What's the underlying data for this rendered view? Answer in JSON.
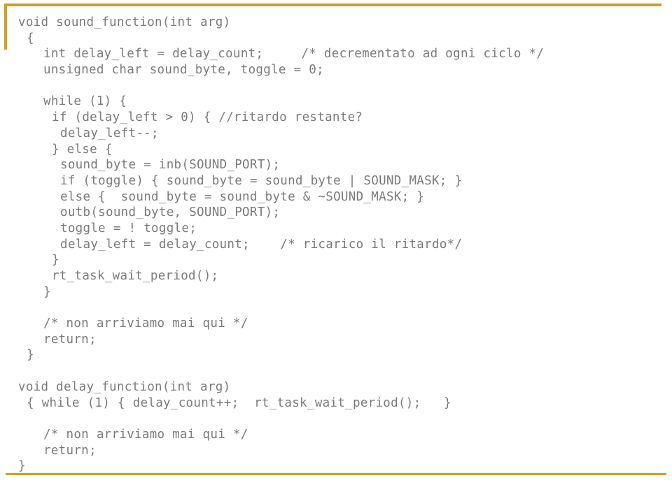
{
  "slide": {
    "accent_color": "#c9a227",
    "text_color": "#7b7b7b",
    "background_color": "#ffffff",
    "decorations": {
      "top_rule": "gold-horizontal-rule",
      "left_rule": "gold-vertical-rule",
      "bottom_rule": "gold-horizontal-rule"
    }
  },
  "code": {
    "language": "c",
    "lines": [
      {
        "indent": 0,
        "text": "void sound_function(int arg)"
      },
      {
        "indent": 1,
        "text": "{"
      },
      {
        "indent": 2,
        "text": "int delay_left = delay_count;     /* decrementato ad ogni ciclo */"
      },
      {
        "indent": 2,
        "text": "unsigned char sound_byte, toggle = 0;"
      },
      {
        "indent": 0,
        "text": "",
        "blank": true
      },
      {
        "indent": 2,
        "text": "while (1) {"
      },
      {
        "indent": 4,
        "text": "if (delay_left > 0) { //ritardo restante?"
      },
      {
        "indent": 5,
        "text": "delay_left--;"
      },
      {
        "indent": 4,
        "text": "} else {"
      },
      {
        "indent": 5,
        "text": "sound_byte = inb(SOUND_PORT);"
      },
      {
        "indent": 5,
        "text": "if (toggle) { sound_byte = sound_byte | SOUND_MASK; }"
      },
      {
        "indent": 5,
        "text": "else {  sound_byte = sound_byte & ~SOUND_MASK; }"
      },
      {
        "indent": 5,
        "text": "outb(sound_byte, SOUND_PORT);"
      },
      {
        "indent": 5,
        "text": "toggle = ! toggle;"
      },
      {
        "indent": 5,
        "text": "delay_left = delay_count;    /* ricarico il ritardo*/"
      },
      {
        "indent": 4,
        "text": "}"
      },
      {
        "indent": 4,
        "text": "rt_task_wait_period();"
      },
      {
        "indent": 2,
        "text": "}"
      },
      {
        "indent": 0,
        "text": "",
        "blank": true
      },
      {
        "indent": 2,
        "text": "/* non arriviamo mai qui */"
      },
      {
        "indent": 2,
        "text": "return;"
      },
      {
        "indent": 1,
        "text": "}"
      },
      {
        "indent": 0,
        "text": "",
        "blank": true
      },
      {
        "indent": 0,
        "text": "void delay_function(int arg)"
      },
      {
        "indent": 1,
        "text": "{ while (1) { delay_count++;  rt_task_wait_period();   }"
      },
      {
        "indent": 0,
        "text": "",
        "blank": true
      },
      {
        "indent": 2,
        "text": "/* non arriviamo mai qui */"
      },
      {
        "indent": 2,
        "text": "return;"
      },
      {
        "indent": 0,
        "text": "}"
      }
    ]
  }
}
